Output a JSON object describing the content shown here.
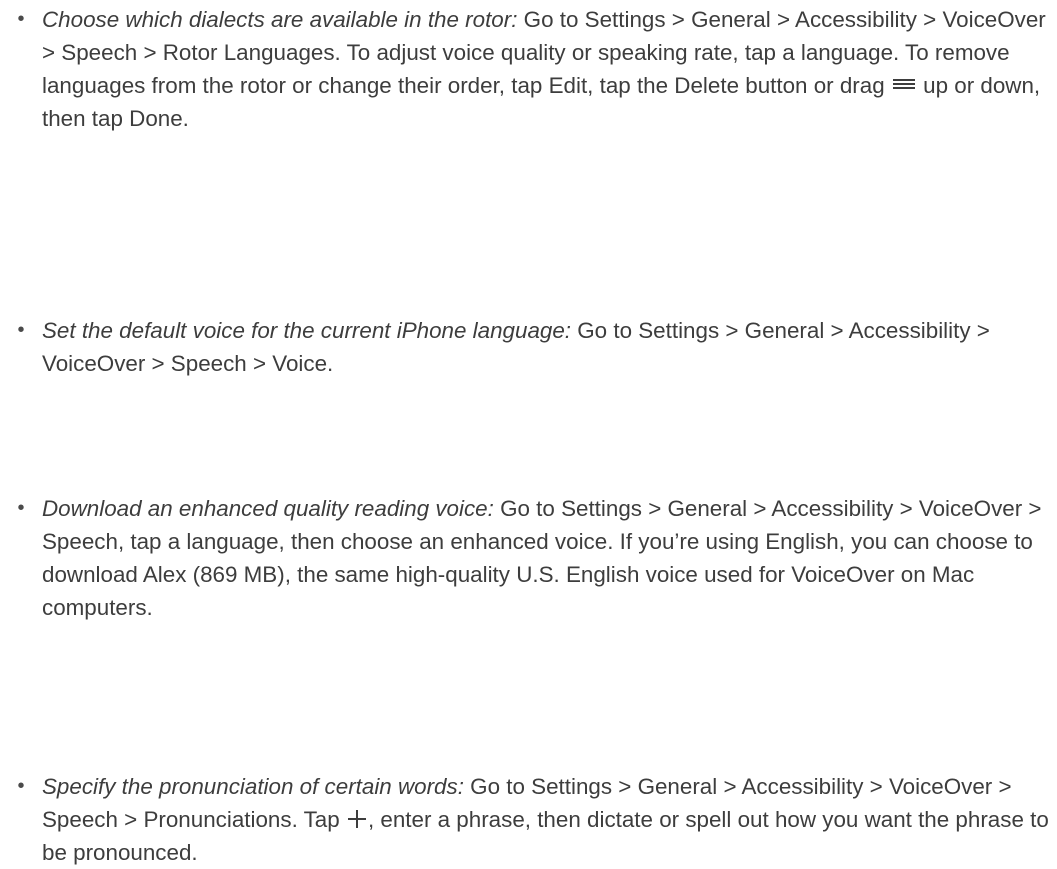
{
  "items": [
    {
      "bullet": "•",
      "lead": "Choose which dialects are available in the rotor:",
      "text_before_icon": " Go to Settings > General > Accessibility > VoiceOver > Speech > Rotor Languages. To adjust voice quality or speaking rate, tap a language. To remove languages from the rotor or change their order, tap Edit, tap the Delete button or drag ",
      "icon": "reorder-icon",
      "text_after_icon": " up or down, then tap Done."
    },
    {
      "bullet": "•",
      "lead": "Set the default voice for the current iPhone language:",
      "text": " Go to Settings > General > Accessibility > VoiceOver > Speech > Voice."
    },
    {
      "bullet": "•",
      "lead": "Download an enhanced quality reading voice:",
      "text": " Go to Settings > General > Accessibility > VoiceOver > Speech, tap a language, then choose an enhanced voice. If you’re using English, you can choose to download Alex (869 MB), the same high-quality U.S. English voice used for VoiceOver on Mac computers."
    },
    {
      "bullet": "•",
      "lead": "Specify the pronunciation of certain words:",
      "text_before_icon": " Go to Settings > General > Accessibility > VoiceOver > Speech > Pronunciations. Tap ",
      "icon": "plus-icon",
      "text_after_icon": ", enter a phrase, then dictate or spell out how you want the phrase to be pronounced."
    }
  ]
}
